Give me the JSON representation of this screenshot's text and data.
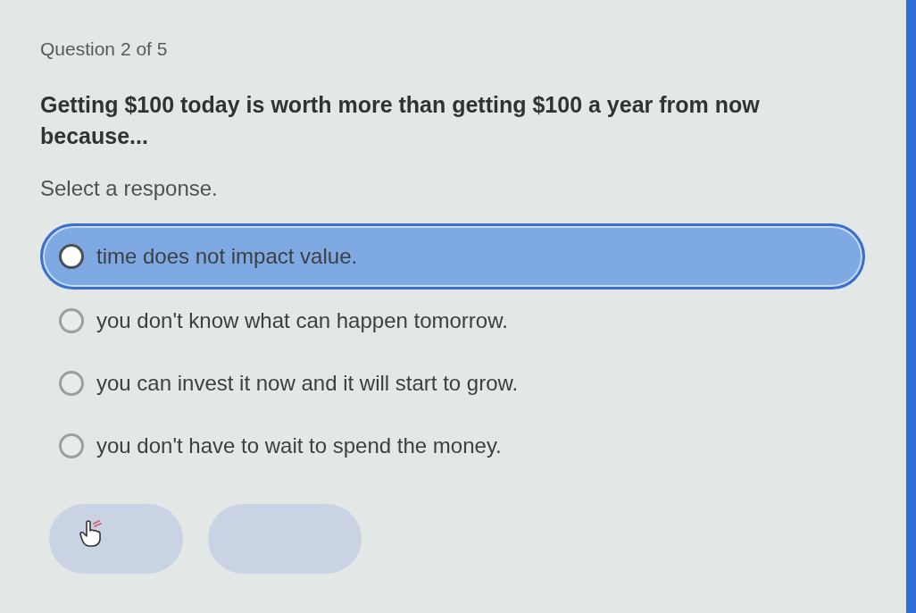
{
  "question_counter": "Question 2 of 5",
  "question": "Getting $100 today is worth more than getting $100 a year from now because...",
  "instruction": "Select a response.",
  "options": [
    {
      "label": "time does not impact value.",
      "selected": true
    },
    {
      "label": "you don't know what can happen tomorrow.",
      "selected": false
    },
    {
      "label": "you can invest it now and it will start to grow.",
      "selected": false
    },
    {
      "label": "you don't have to wait to spend the money.",
      "selected": false
    }
  ],
  "buttons": [
    {
      "disabled": true,
      "hovered": true
    },
    {
      "disabled": true,
      "hovered": false
    }
  ]
}
